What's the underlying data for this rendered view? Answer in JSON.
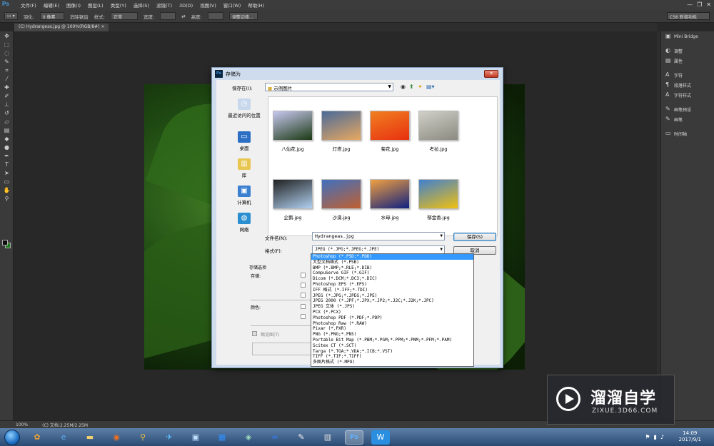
{
  "app": {
    "logo": "Ps",
    "menus": [
      "文件(F)",
      "编辑(E)",
      "图像(I)",
      "图层(L)",
      "类型(Y)",
      "选择(S)",
      "滤镜(T)",
      "3D(D)",
      "视图(V)",
      "窗口(W)",
      "帮助(H)"
    ],
    "window_buttons": [
      "—",
      "❐",
      "✕"
    ]
  },
  "options": {
    "feather_label": "羽化:",
    "feather_value": "0 像素",
    "antialias_label": "消除锯齿",
    "style_label": "样式:",
    "style_value": "正常",
    "width_label": "宽度:",
    "height_label": "高度:",
    "refine_button": "调整边缘...",
    "workspace": "CS6 新增功能"
  },
  "document": {
    "tab_label": "(C) Hydrangeas.jpg @ 100%(RGB/8#)",
    "zoom": "100%",
    "doc_info": "(C) 文档:2.25M/2.25M"
  },
  "right_panels": [
    {
      "icon": "mini-bridge-icon",
      "label": "Mini Bridge"
    },
    {
      "icon": "adjustments-icon",
      "label": "调整"
    },
    {
      "icon": "properties-icon",
      "label": "属性"
    },
    {
      "icon": "character-icon",
      "label": "字符"
    },
    {
      "icon": "paragraph-style-icon",
      "label": "段落样式"
    },
    {
      "icon": "character-style-icon",
      "label": "字符样式"
    },
    {
      "icon": "brush-presets-icon",
      "label": "画笔预设"
    },
    {
      "icon": "brush-icon",
      "label": "画笔"
    },
    {
      "icon": "timeline-icon",
      "label": "时间轴"
    }
  ],
  "dialog": {
    "title": "存储为",
    "save_in_label": "保存在(I):",
    "save_in_value": "示例图片",
    "places": [
      {
        "label": "最近访问的位置",
        "color": "#c8d8ec"
      },
      {
        "label": "桌面",
        "color": "#2d6fc4"
      },
      {
        "label": "库",
        "color": "#e8c650"
      },
      {
        "label": "计算机",
        "color": "#3a7fd0"
      },
      {
        "label": "网络",
        "color": "#2a8fd0"
      }
    ],
    "files": [
      {
        "name": "八仙花.jpg",
        "colors": [
          "#1c3a14",
          "#c8c8f0"
        ]
      },
      {
        "name": "灯塔.jpg",
        "colors": [
          "#e8a860",
          "#4a6a9a"
        ]
      },
      {
        "name": "菊花.jpg",
        "colors": [
          "#e83010",
          "#f08020"
        ]
      },
      {
        "name": "考拉.jpg",
        "colors": [
          "#8a8a80",
          "#d0d0c8"
        ]
      },
      {
        "name": "企鹅.jpg",
        "colors": [
          "#b0d0f0",
          "#202020"
        ]
      },
      {
        "name": "沙漠.jpg",
        "colors": [
          "#c06030",
          "#4070c0"
        ]
      },
      {
        "name": "水母.jpg",
        "colors": [
          "#102080",
          "#f0a040"
        ]
      },
      {
        "name": "郁金香.jpg",
        "colors": [
          "#f0c010",
          "#4080d0"
        ]
      }
    ],
    "filename_label": "文件名(N):",
    "filename_value": "Hydrangeas.jpg",
    "format_label": "格式(F):",
    "format_value": "JPEG (*.JPG;*.JPEG;*.JPE)",
    "save_button": "保存(S)",
    "cancel_button": "取消",
    "save_options_title": "存储选项",
    "store_label": "存储:",
    "color_label": "颜色:",
    "thumbnail_label": "缩览图(T)",
    "format_options": [
      "Photoshop (*.PSD;*.PDD)",
      "大型文档格式 (*.PSB)",
      "BMP (*.BMP;*.RLE;*.DIB)",
      "CompuServe GIF (*.GIF)",
      "Dicom (*.DCM;*.DC3;*.DIC)",
      "Photoshop EPS (*.EPS)",
      "IFF 格式 (*.IFF;*.TDI)",
      "JPEG (*.JPG;*.JPEG;*.JPE)",
      "JPEG 2000 (*.JPF;*.JPX;*.JP2;*.J2C;*.J2K;*.JPC)",
      "JPEG 立体 (*.JPS)",
      "PCX (*.PCX)",
      "Photoshop PDF (*.PDF;*.PDP)",
      "Photoshop Raw (*.RAW)",
      "Pixar (*.PXR)",
      "PNG (*.PNG;*.PNS)",
      "Portable Bit Map (*.PBM;*.PGM;*.PPM;*.PNM;*.PFM;*.PAM)",
      "Scitex CT (*.SCT)",
      "Targa (*.TGA;*.VDA;*.ICB;*.VST)",
      "TIFF (*.TIF;*.TIFF)",
      "多图片格式 (*.MPO)"
    ],
    "selected_format_index": 0
  },
  "taskbar": {
    "time": "14:09",
    "date": "2017/9/1"
  },
  "watermark": {
    "title": "溜溜自学",
    "subtitle": "ZIXUE.3D66.COM"
  }
}
